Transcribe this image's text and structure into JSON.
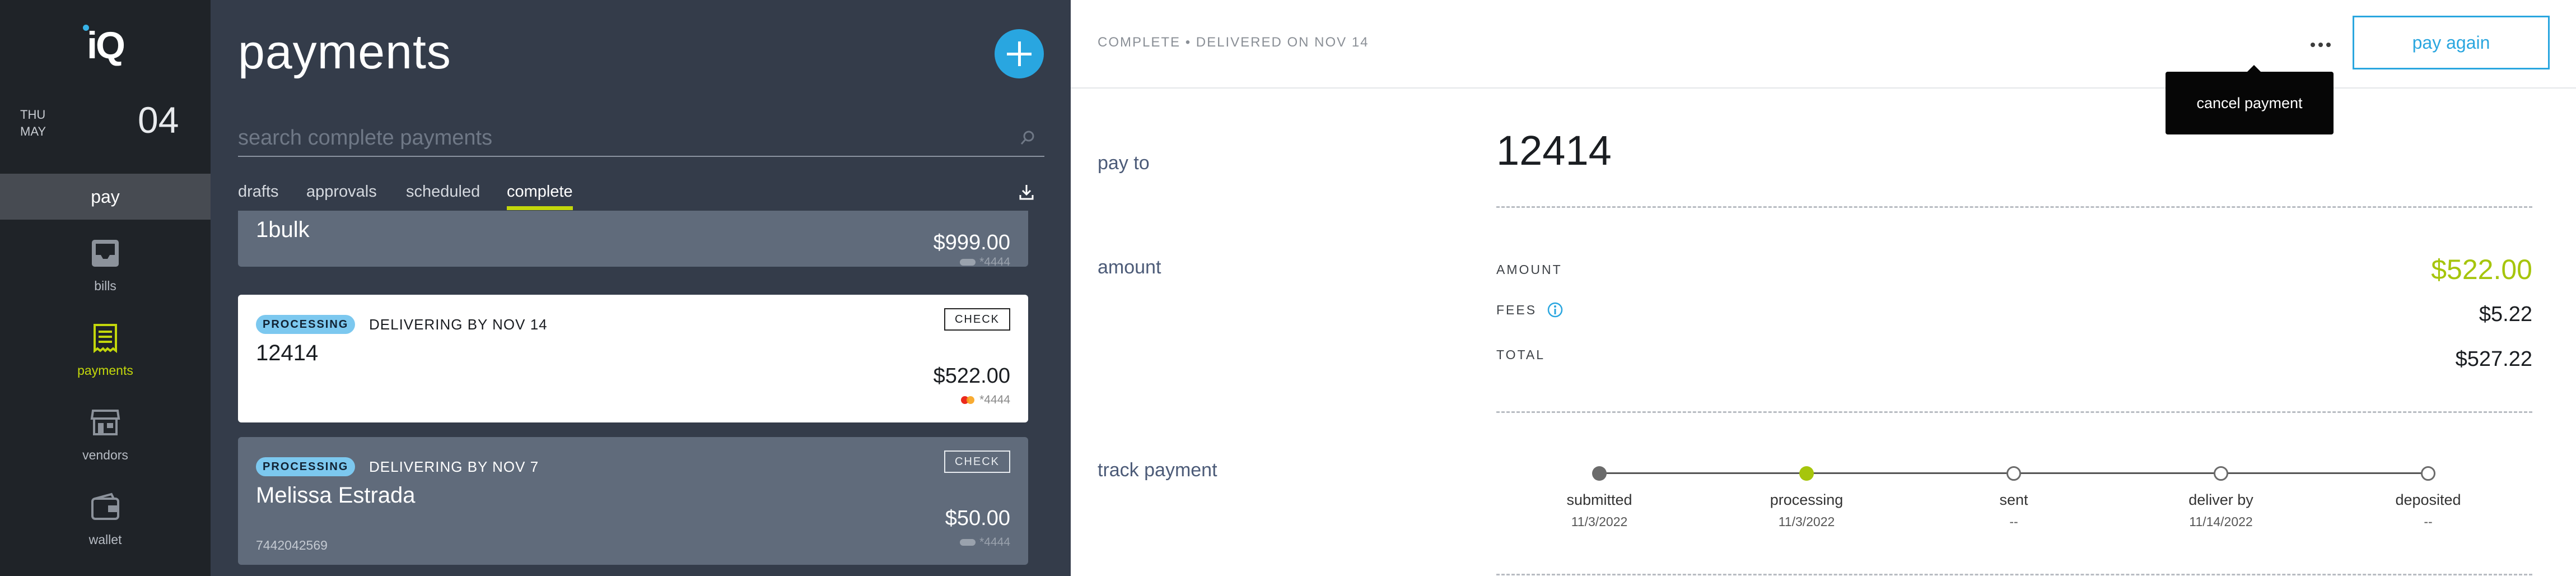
{
  "app": {
    "logo": "iQ"
  },
  "date": {
    "weekday": "THU",
    "month": "MAY",
    "day": "04"
  },
  "nav": {
    "pay": "pay",
    "items": [
      {
        "label": "bills",
        "icon": "inbox-icon",
        "active": false
      },
      {
        "label": "payments",
        "icon": "receipt-icon",
        "active": true
      },
      {
        "label": "vendors",
        "icon": "store-icon",
        "active": false
      },
      {
        "label": "wallet",
        "icon": "wallet-icon",
        "active": false
      }
    ]
  },
  "payments": {
    "title": "payments",
    "search_placeholder": "search complete payments",
    "tabs": [
      "drafts",
      "approvals",
      "scheduled",
      "complete"
    ],
    "active_tab": "complete"
  },
  "list": [
    {
      "name": "1bulk",
      "amount": "$999.00",
      "account": "*4444"
    },
    {
      "status": "PROCESSING",
      "delivery": "DELIVERING BY NOV 14",
      "method": "CHECK",
      "name": "12414",
      "amount": "$522.00",
      "account": "*4444",
      "selected": true
    },
    {
      "status": "PROCESSING",
      "delivery": "DELIVERING BY NOV 7",
      "method": "CHECK",
      "name": "Melissa Estrada",
      "number": "7442042569",
      "amount": "$50.00",
      "account": "*4444"
    }
  ],
  "detail": {
    "status_line": "COMPLETE • DELIVERED ON NOV 14",
    "pay_again": "pay again",
    "tooltip": "cancel payment",
    "pay_to_label": "pay to",
    "pay_to": "12414",
    "amount_label": "amount",
    "amount_title": "AMOUNT",
    "amount_value": "$522.00",
    "fees_title": "FEES",
    "fees_value": "$5.22",
    "total_title": "TOTAL",
    "total_value": "$527.22",
    "track_label": "track payment",
    "steps": [
      {
        "name": "submitted",
        "date": "11/3/2022"
      },
      {
        "name": "processing",
        "date": "11/3/2022"
      },
      {
        "name": "sent",
        "date": "--"
      },
      {
        "name": "deliver by",
        "date": "11/14/2022"
      },
      {
        "name": "deposited",
        "date": "--"
      }
    ]
  },
  "colors": {
    "accent": "#c3d70b",
    "blue": "#29a6e0",
    "amount_green": "#a6c50c"
  }
}
